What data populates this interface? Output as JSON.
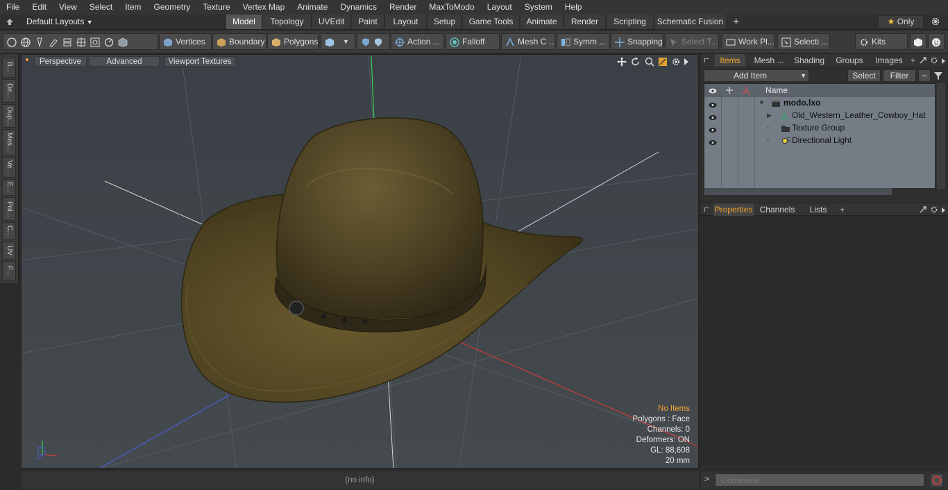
{
  "menu": [
    "File",
    "Edit",
    "View",
    "Select",
    "Item",
    "Geometry",
    "Texture",
    "Vertex Map",
    "Animate",
    "Dynamics",
    "Render",
    "MaxToModo",
    "Layout",
    "System",
    "Help"
  ],
  "layout_selector": "Default Layouts",
  "layout_tabs": [
    {
      "label": "Model",
      "active": true
    },
    {
      "label": "Topology"
    },
    {
      "label": "UVEdit"
    },
    {
      "label": "Paint"
    },
    {
      "label": "Layout"
    },
    {
      "label": "Setup"
    },
    {
      "label": "Game Tools"
    },
    {
      "label": "Animate"
    },
    {
      "label": "Render"
    },
    {
      "label": "Scripting"
    },
    {
      "label": "Schematic Fusion"
    }
  ],
  "only_label": "Only",
  "toolbar": {
    "vertices": "Vertices",
    "boundary": "Boundary",
    "polygons": "Polygons",
    "action": "Action ...",
    "falloff": "Falloff",
    "mesh_c": "Mesh C ...",
    "symm": "Symm ...",
    "snapping": "Snapping",
    "select_t": "Select T...",
    "work_pl": "Work Pl...",
    "selecti": "Selecti ...",
    "kits": "Kits"
  },
  "left_tabs": [
    "B...",
    "De...",
    "Dup...",
    "Mes...",
    "Ve...",
    "E...",
    "Pol...",
    "C...",
    "UV",
    "F..."
  ],
  "viewport": {
    "tabs": [
      "Perspective",
      "Advanced",
      "Viewport Textures"
    ],
    "stats": {
      "no_items": "No Items",
      "polygons": "Polygons : Face",
      "channels": "Channels: 0",
      "deformers": "Deformers: ON",
      "gl": "GL: 88,608",
      "size": "20 mm"
    },
    "accent_color": "#f0a22e"
  },
  "status_text": "(no info)",
  "items_panel": {
    "tabs": [
      "Items",
      "Mesh ...",
      "Shading",
      "Groups",
      "Images"
    ],
    "add_item": "Add Item",
    "select": "Select",
    "filter": "Filter",
    "column_name": "Name",
    "tree": [
      {
        "label": "modo.lxo",
        "type": "scene"
      },
      {
        "label": "Old_Western_Leather_Cowboy_Hat",
        "type": "mesh"
      },
      {
        "label": "Texture Group",
        "type": "texture"
      },
      {
        "label": "Directional Light",
        "type": "light"
      }
    ]
  },
  "properties_panel": {
    "tabs": [
      "Properties",
      "Channels",
      "Lists"
    ]
  },
  "command_placeholder": "Command"
}
